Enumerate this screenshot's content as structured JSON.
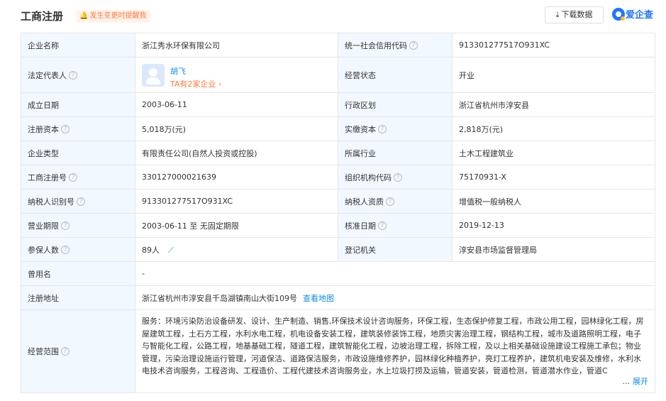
{
  "header": {
    "title": "工商注册",
    "notice": "发生变更时提醒我",
    "download_label": "下载数据",
    "brand": "爱企查"
  },
  "rows": [
    {
      "k1": "企业名称",
      "v1": "浙江秀水环保有限公司",
      "k2": "统一社会信用代码",
      "v2": "913301277517O931XC"
    },
    {
      "k1": "法定代表人",
      "rep_name": "胡飞",
      "rep_more": "TA有2家企业",
      "k2": "经营状态",
      "v2": "开业"
    },
    {
      "k1": "成立日期",
      "v1": "2003-06-11",
      "k2": "行政区划",
      "v2": "浙江省杭州市淳安县"
    },
    {
      "k1": "注册资本",
      "v1": "5,018万(元)",
      "k2": "实缴资本",
      "v2": "2,818万(元)"
    },
    {
      "k1": "企业类型",
      "v1": "有限责任公司(自然人投资或控股)",
      "k2": "所属行业",
      "v2": "土木工程建筑业"
    },
    {
      "k1": "工商注册号",
      "v1": "330127000021639",
      "k2": "组织机构代码",
      "v2": "75170931-X"
    },
    {
      "k1": "纳税人识别号",
      "v1": "913301277517O931XC",
      "k2": "纳税人资质",
      "v2": "增值税一般纳税人"
    },
    {
      "k1": "营业期限",
      "v1": "2003-06-11 至 无固定期限",
      "k2": "核准日期",
      "v2": "2019-12-13"
    },
    {
      "k1": "参保人数",
      "v1": "89人",
      "k2": "登记机关",
      "v2": "淳安县市场监督管理局"
    },
    {
      "k1": "曾用名",
      "v1": "-"
    },
    {
      "k1": "注册地址",
      "v1": "浙江省杭州市淳安县千岛湖镇南山大街109号",
      "link": "查看地图"
    },
    {
      "k1": "经营范围",
      "v1": "服务：环境污染防治设备研发、设计、生产制造、销售,环保技术设计咨询服务，环保工程，生态保护修复工程，市政公用工程，园林绿化工程，房屋建筑工程，土石方工程，水利水电工程，机电设备安装工程，建筑装修装饰工程，地质灾害治理工程，钢结构工程，城市及道路照明工程，电子与智能化工程，公路工程，地基基础工程，隧道工程，建筑智能化工程，边坡治理工程，拆除工程，及以上相关基础设施建设工程施工承包；物业管理，污染治理设施运行管理，河道保洁、道路保洁服务，市政设施维修养护，园林绿化种植养护，亮灯工程养护，建筑机电安装及维修，水利水电技术咨询服务，工程咨询、工程造价、工程代建技术咨询服务业，水上垃圾打捞及运输，管道安装，管道检测，管道潜水作业，管道C",
      "ellipsis": "...",
      "expand": "展开"
    }
  ]
}
